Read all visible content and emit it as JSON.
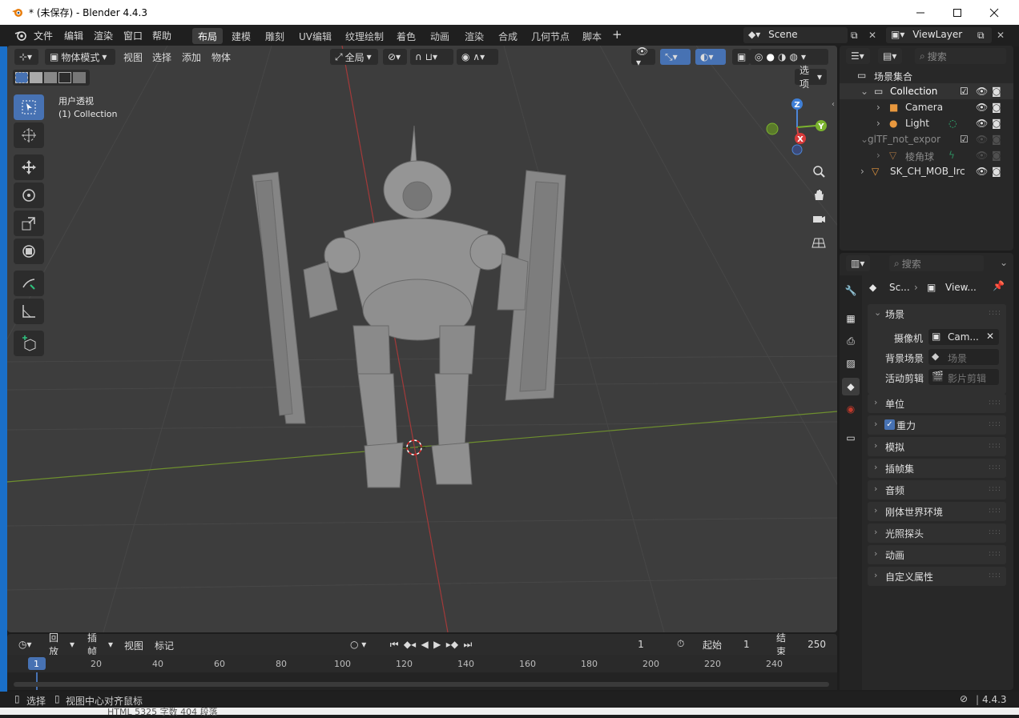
{
  "window": {
    "title": "* (未保存) - Blender 4.4.3"
  },
  "menu": [
    "文件",
    "编辑",
    "渲染",
    "窗口",
    "帮助"
  ],
  "workspaces": [
    "布局",
    "建模",
    "雕刻",
    "UV编辑",
    "纹理绘制",
    "着色",
    "动画",
    "渲染",
    "合成",
    "几何节点",
    "脚本"
  ],
  "scene_field": "Scene",
  "viewlayer_field": "ViewLayer",
  "viewport": {
    "mode": "物体模式",
    "menus": [
      "视图",
      "选择",
      "添加",
      "物体"
    ],
    "transform": "全局",
    "options": "选项",
    "view_name": "用户透视",
    "collection_label": "(1) Collection",
    "gizmo": {
      "x": "X",
      "y": "Y",
      "z": "Z"
    }
  },
  "outliner": {
    "search_placeholder": "搜索",
    "root": "场景集合",
    "items": [
      {
        "label": "Collection"
      },
      {
        "label": "Camera"
      },
      {
        "label": "Light"
      },
      {
        "label": "glTF_not_expor"
      },
      {
        "label": "棱角球"
      },
      {
        "label": "SK_CH_MOB_Irc"
      }
    ]
  },
  "properties": {
    "search_placeholder": "搜索",
    "breadcrumb_scene": "Sc...",
    "breadcrumb_view": "View...",
    "scene_panel": "场景",
    "camera_label": "摄像机",
    "camera_value": "Cam...",
    "bg_label": "背景场景",
    "bg_placeholder": "场景",
    "clip_label": "活动剪辑",
    "clip_placeholder": "影片剪辑",
    "panels": [
      "单位",
      "重力",
      "模拟",
      "插帧集",
      "音频",
      "刚体世界环境",
      "光照探头",
      "动画",
      "自定义属性"
    ]
  },
  "timeline": {
    "menus": [
      "回放",
      "插帧",
      "视图",
      "标记"
    ],
    "current_frame": "1",
    "start_label": "起始",
    "start_value": "1",
    "end_label": "结束",
    "end_value": "250",
    "ruler": [
      "1",
      "20",
      "40",
      "60",
      "80",
      "100",
      "120",
      "140",
      "160",
      "180",
      "200",
      "220",
      "240"
    ]
  },
  "status": {
    "select": "选择",
    "center": "视图中心对齐鼠标",
    "version": "4.4.3"
  },
  "taskbar_text": "HTML  5325 字数  404 段落"
}
